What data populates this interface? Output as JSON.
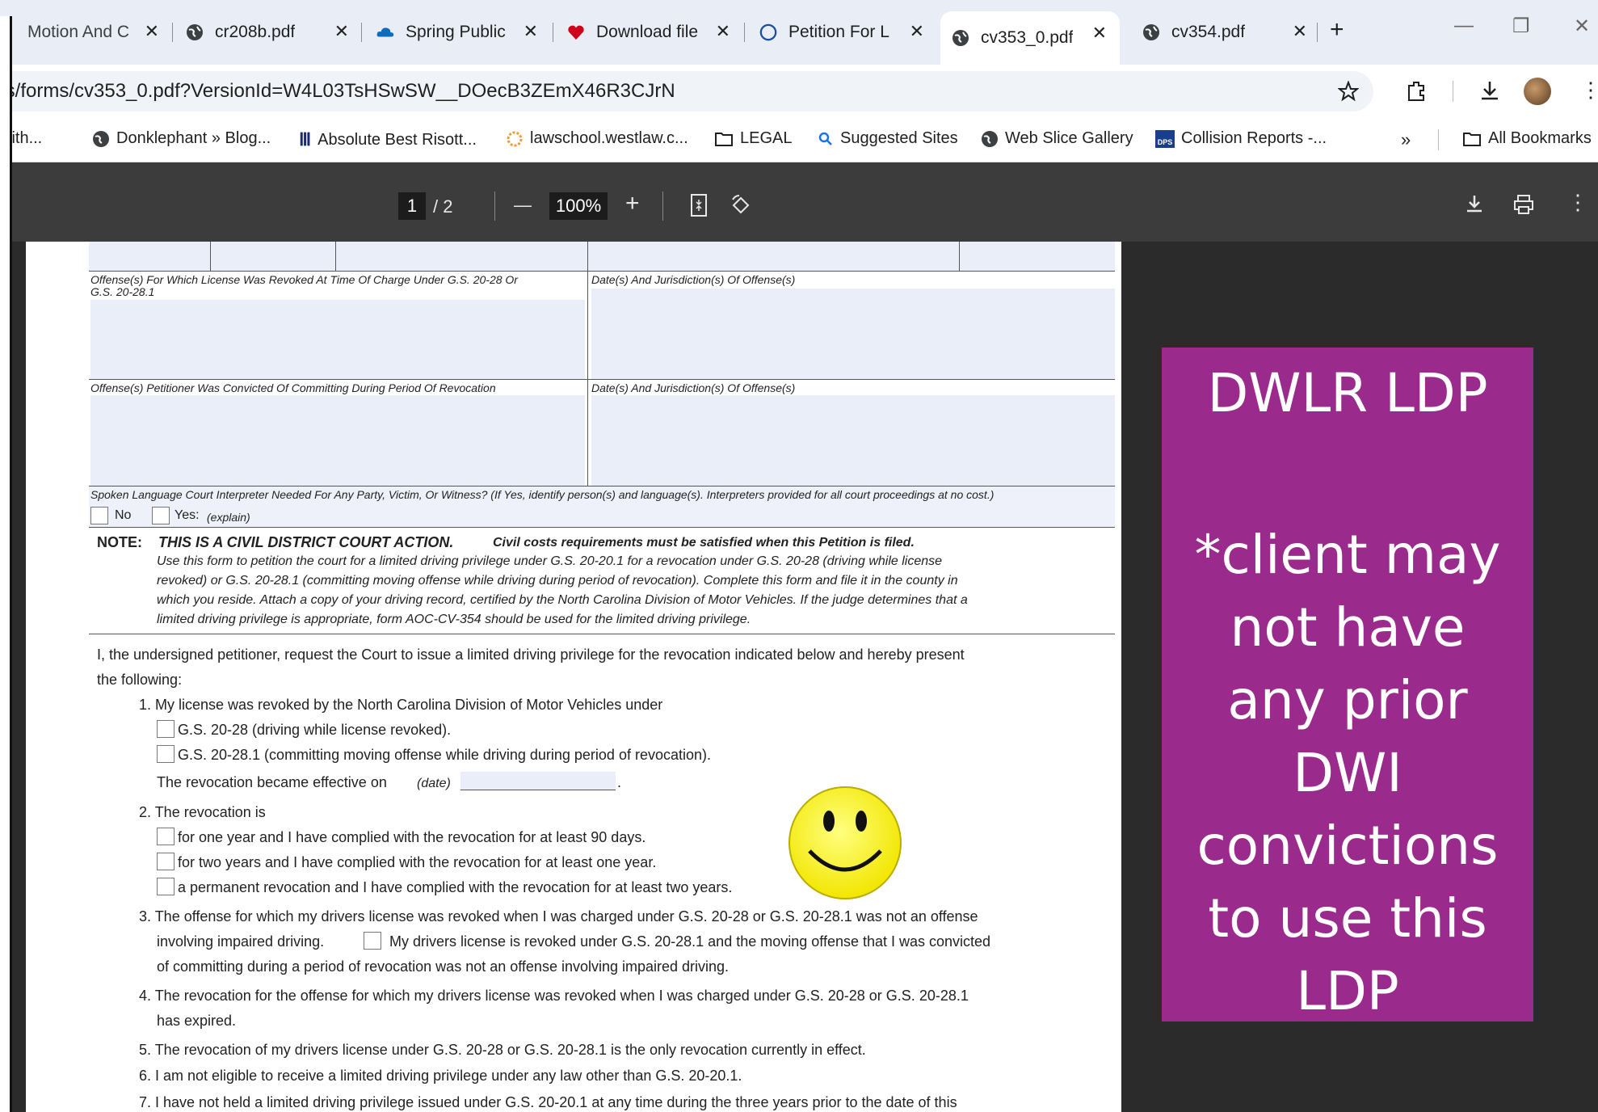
{
  "tabs": [
    {
      "label": "Motion And C",
      "favicon": "globe-icon"
    },
    {
      "label": "cr208b.pdf",
      "favicon": "globe-icon"
    },
    {
      "label": "Spring Public",
      "favicon": "cloud-icon"
    },
    {
      "label": "Download file",
      "favicon": "heart-icon"
    },
    {
      "label": "Petition For L",
      "favicon": "circle-icon"
    },
    {
      "label": "cv353_0.pdf",
      "favicon": "globe-icon"
    },
    {
      "label": "cv354.pdf",
      "favicon": "globe-icon"
    }
  ],
  "tab_close": "✕",
  "new_tab": "+",
  "window": {
    "minimize": "—",
    "restore": "❐",
    "close": "✕"
  },
  "address": {
    "url": "ts/forms/cv353_0.pdf?VersionId=W4L03TsHSwSW__DOecB3ZEmX46R3CJrN"
  },
  "bookmarks": {
    "items": [
      "with...",
      "Donklephant » Blog...",
      "Absolute Best Risott...",
      "lawschool.westlaw.c...",
      "LEGAL",
      "Suggested Sites",
      "Web Slice Gallery",
      "Collision Reports -..."
    ],
    "more": "»",
    "all": "All Bookmarks"
  },
  "pdf_toolbar": {
    "page": "1",
    "of": "/ 2",
    "zoom": "100%",
    "minus": "—",
    "plus": "+"
  },
  "form": {
    "offense_revoked_label": "Offense(s) For Which License Was Revoked At Time Of Charge Under G.S. 20-28 Or",
    "offense_revoked_label2": "G.S. 20-28.1",
    "date_jurisdiction_label": "Date(s) And Jurisdiction(s) Of Offense(s)",
    "offense_convicted_label": "Offense(s) Petitioner Was Convicted Of Committing During Period Of Revocation",
    "date_jurisdiction_label2": "Date(s) And Jurisdiction(s) Of Offense(s)",
    "interpreter_label": "Spoken Language Court Interpreter Needed For Any Party, Victim, Or Witness? (If Yes, identify person(s) and language(s). Interpreters provided for all court proceedings at no cost.)",
    "no": "No",
    "yes": "Yes:",
    "yes_explain": "(explain)",
    "note_label": "NOTE:",
    "note_bold": "THIS IS A CIVIL DISTRICT COURT ACTION.",
    "note_bold2": "Civil costs requirements must be satisfied when this Petition is filed.",
    "note_lines": [
      "Use this form to petition the court for a limited driving privilege under G.S. 20-20.1 for a revocation under G.S. 20-28 (driving while license",
      "revoked) or G.S. 20-28.1 (committing moving offense while driving during period of revocation). Complete this form and file it in the county in",
      "which you reside. Attach a copy of your driving record, certified by the North Carolina Division of Motor Vehicles. If the judge determines that a",
      "limited driving privilege is appropriate, form AOC-CV-354 should be used for the limited driving privilege."
    ],
    "intro1": "I, the undersigned petitioner, request the Court to issue a limited driving privilege for the revocation indicated below and hereby present",
    "intro2": "the following:",
    "item1": "1. My license was revoked by the North Carolina Division of Motor Vehicles under",
    "item1a": "G.S. 20-28 (driving while license revoked).",
    "item1b": "G.S. 20-28.1 (committing moving offense while driving during period of revocation).",
    "item1c": "The revocation became effective on",
    "item1c_date": "(date)",
    "item2": "2. The revocation is",
    "item2a": "for one year and I have complied with the revocation for at least 90 days.",
    "item2b": "for two years and I have complied with the revocation for at least one year.",
    "item2c": "a permanent revocation and I have complied with the revocation for at least two years.",
    "item3a": "3. The offense for which my drivers license was revoked when I was charged under G.S. 20-28 or G.S. 20-28.1 was not an offense",
    "item3b": "involving impaired driving.",
    "item3c": "My drivers license is revoked under G.S. 20-28.1 and the moving offense that I was convicted",
    "item3d": "of committing during a period of revocation was not an offense involving impaired driving.",
    "item4a": "4. The revocation for the offense for which my drivers license was revoked when I was charged under G.S. 20-28 or G.S. 20-28.1",
    "item4b": "has expired.",
    "item5": "5. The revocation of my drivers license under G.S. 20-28 or G.S. 20-28.1 is the only revocation currently in effect.",
    "item6": "6. I am not eligible to receive a limited driving privilege under any law other than G.S. 20-20.1.",
    "item7": "7. I have not held a limited driving privilege issued under G.S. 20-20.1 at any time during the three years prior to the date of this"
  },
  "slide": {
    "title": "DWLR LDP",
    "body": "*client may\nnot have\nany prior\nDWI\nconvictions\nto use this\nLDP"
  }
}
